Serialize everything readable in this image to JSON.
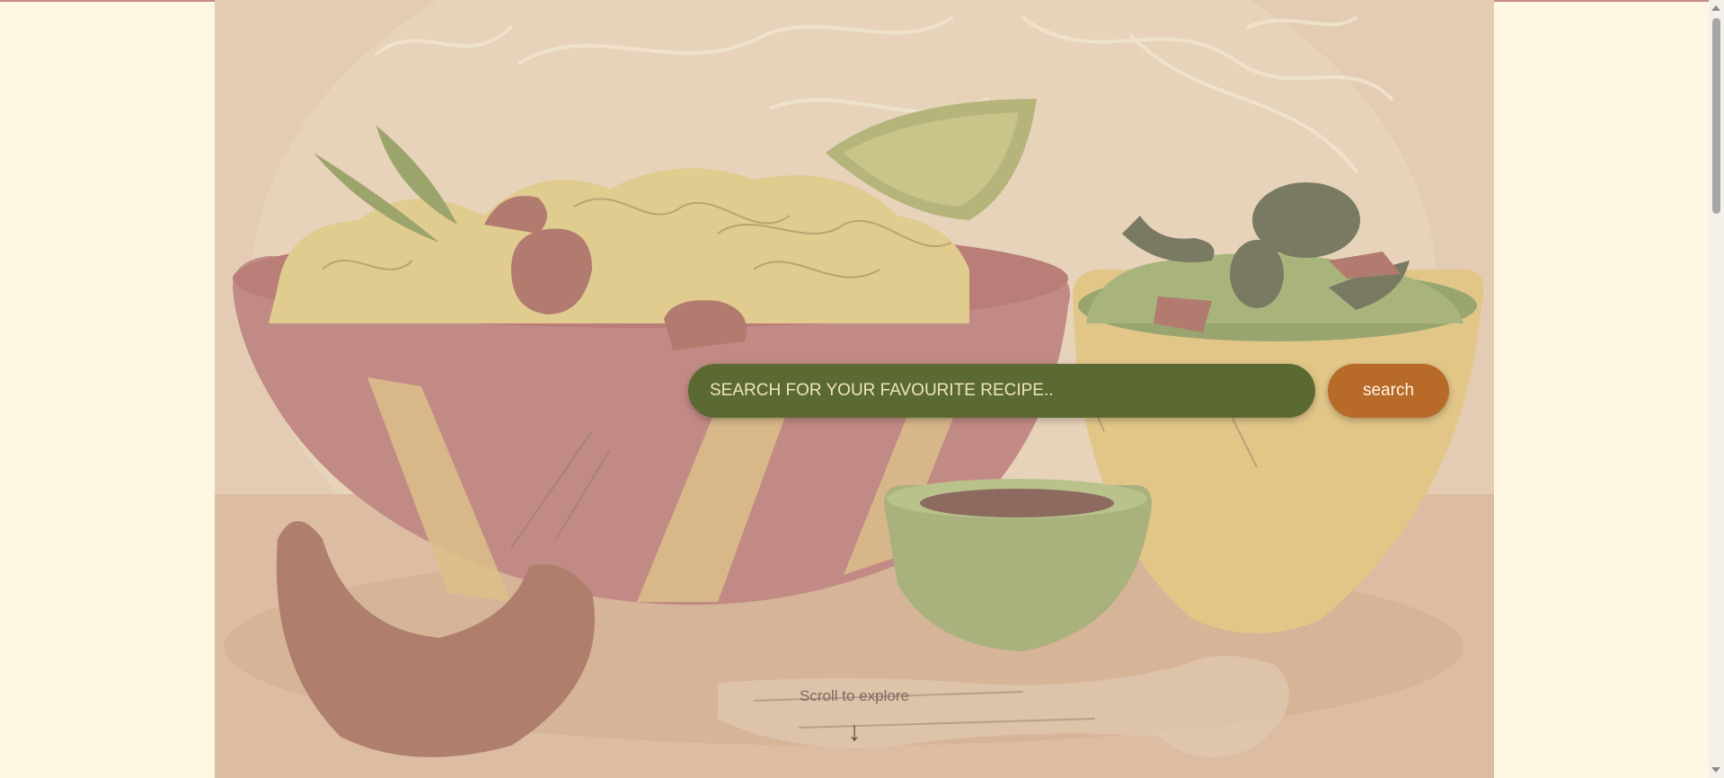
{
  "search": {
    "placeholder": "SEARCH FOR YOUR FAVOURITE RECIPE..",
    "button_label": "search"
  },
  "hint": {
    "text": "Scroll to explore",
    "arrow": "↓"
  },
  "colors": {
    "page_background": "#fdf7e1",
    "search_field": "#5b6a33",
    "search_button": "#b86a28"
  },
  "icons": {
    "scroll_arrow": "down-arrow-icon"
  },
  "illustration": {
    "subject": "food-bowls-illustration"
  }
}
